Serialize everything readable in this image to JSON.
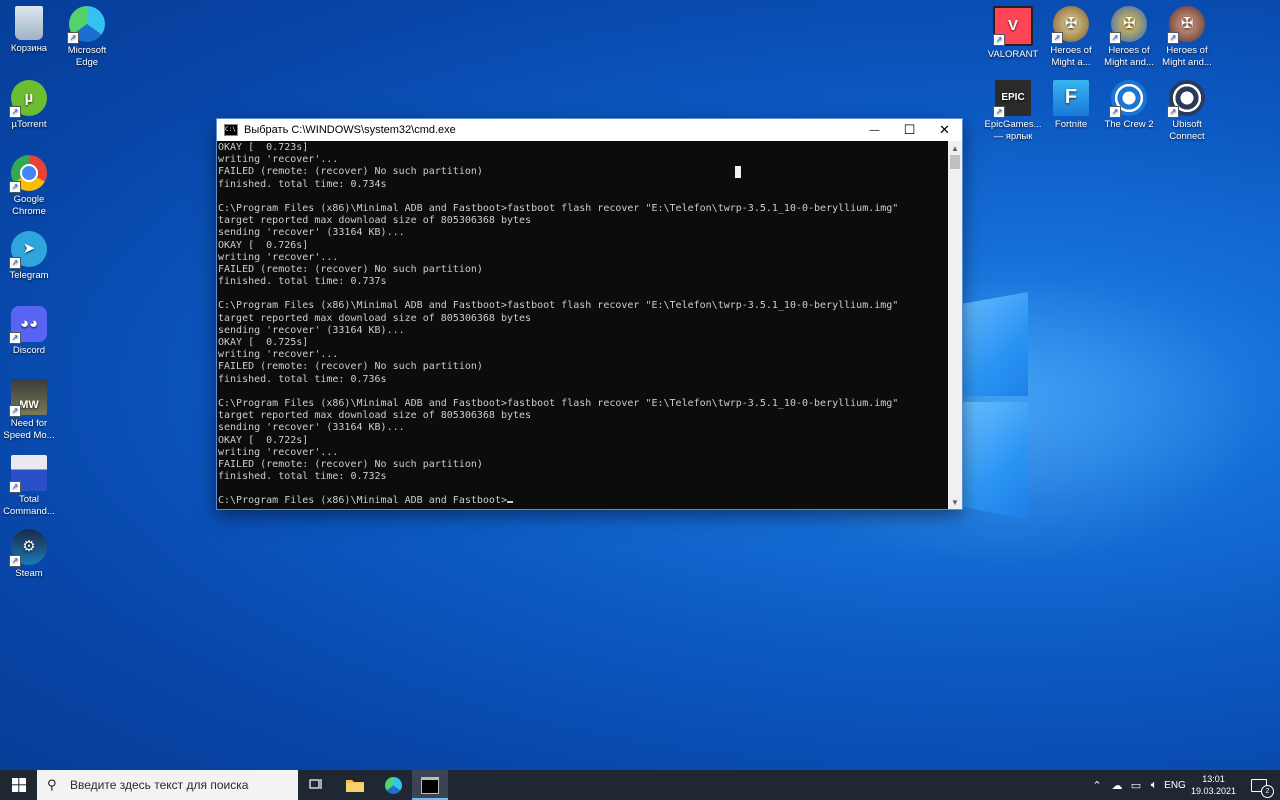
{
  "desktop": {
    "left_icons": [
      {
        "label": "Корзина",
        "icon": "recycle-bin-icon"
      },
      {
        "label": "Microsoft Edge",
        "icon": "edge-icon"
      },
      {
        "label": "µTorrent",
        "icon": "utorrent-icon"
      },
      {
        "label": "Google Chrome",
        "icon": "chrome-icon"
      },
      {
        "label": "Telegram",
        "icon": "telegram-icon"
      },
      {
        "label": "Discord",
        "icon": "discord-icon"
      },
      {
        "label": "Need for Speed Mo...",
        "icon": "nfs-mw-icon",
        "badge": "MW"
      },
      {
        "label": "Total Command...",
        "icon": "total-commander-icon"
      },
      {
        "label": "Steam",
        "icon": "steam-icon"
      }
    ],
    "right_icons": [
      {
        "label": "VALORANT",
        "icon": "valorant-icon"
      },
      {
        "label": "Heroes of Might a...",
        "icon": "heroes-icon"
      },
      {
        "label": "Heroes of Might and...",
        "icon": "heroes-icon"
      },
      {
        "label": "Heroes of Might and...",
        "icon": "heroes-icon"
      },
      {
        "label": "EpicGames... — ярлык",
        "icon": "epic-games-icon",
        "badge": "EPIC"
      },
      {
        "label": "Fortnite",
        "icon": "fortnite-icon",
        "badge": "F"
      },
      {
        "label": "The Crew 2",
        "icon": "ubisoft-icon"
      },
      {
        "label": "Ubisoft Connect",
        "icon": "ubisoft-icon"
      }
    ]
  },
  "cmd_window": {
    "title": "Выбрать C:\\WINDOWS\\system32\\cmd.exe",
    "icon_text": "C:\\",
    "minimize": "—",
    "maximize": "☐",
    "close": "✕",
    "lines": [
      "OKAY [  0.723s]",
      "writing 'recover'...",
      "FAILED (remote: (recover) No such partition)",
      "finished. total time: 0.734s",
      "",
      "C:\\Program Files (x86)\\Minimal ADB and Fastboot>fastboot flash recover \"E:\\Telefon\\twrp-3.5.1_10-0-beryllium.img\"",
      "target reported max download size of 805306368 bytes",
      "sending 'recover' (33164 KB)...",
      "OKAY [  0.726s]",
      "writing 'recover'...",
      "FAILED (remote: (recover) No such partition)",
      "finished. total time: 0.737s",
      "",
      "C:\\Program Files (x86)\\Minimal ADB and Fastboot>fastboot flash recover \"E:\\Telefon\\twrp-3.5.1_10-0-beryllium.img\"",
      "target reported max download size of 805306368 bytes",
      "sending 'recover' (33164 KB)...",
      "OKAY [  0.725s]",
      "writing 'recover'...",
      "FAILED (remote: (recover) No such partition)",
      "finished. total time: 0.736s",
      "",
      "C:\\Program Files (x86)\\Minimal ADB and Fastboot>fastboot flash recover \"E:\\Telefon\\twrp-3.5.1_10-0-beryllium.img\"",
      "target reported max download size of 805306368 bytes",
      "sending 'recover' (33164 KB)...",
      "OKAY [  0.722s]",
      "writing 'recover'...",
      "FAILED (remote: (recover) No such partition)",
      "finished. total time: 0.732s",
      ""
    ],
    "prompt": "C:\\Program Files (x86)\\Minimal ADB and Fastboot>"
  },
  "taskbar": {
    "search_placeholder": "Введите здесь текст для поиска",
    "language": "ENG",
    "time": "13:01",
    "date": "19.03.2021",
    "notification_count": "2",
    "colors": {
      "taskbar": "#1f2733",
      "active_indicator": "#76b9ed"
    }
  }
}
